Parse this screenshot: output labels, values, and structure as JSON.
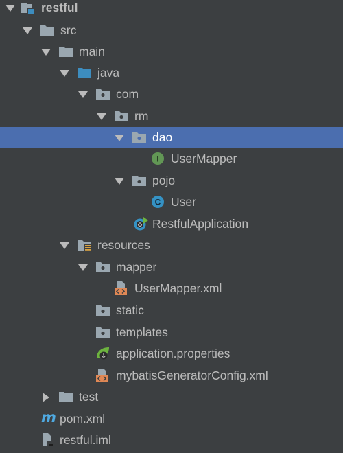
{
  "project_tree": {
    "root": {
      "label": "restful",
      "icon": "module-folder-icon"
    },
    "src": {
      "label": "src",
      "icon": "folder-icon"
    },
    "main": {
      "label": "main",
      "icon": "folder-icon"
    },
    "java": {
      "label": "java",
      "icon": "source-root-folder-icon"
    },
    "com": {
      "label": "com",
      "icon": "package-icon"
    },
    "rm": {
      "label": "rm",
      "icon": "package-icon"
    },
    "dao": {
      "label": "dao",
      "icon": "package-icon",
      "selected": true
    },
    "user_mapper": {
      "label": "UserMapper",
      "icon": "interface-icon",
      "badge": "I"
    },
    "pojo": {
      "label": "pojo",
      "icon": "package-icon"
    },
    "user": {
      "label": "User",
      "icon": "class-icon",
      "badge": "C"
    },
    "restful_application": {
      "label": "RestfulApplication",
      "icon": "spring-boot-app-icon"
    },
    "resources": {
      "label": "resources",
      "icon": "resources-root-icon"
    },
    "mapper": {
      "label": "mapper",
      "icon": "package-icon"
    },
    "user_mapper_xml": {
      "label": "UserMapper.xml",
      "icon": "xml-file-icon"
    },
    "static": {
      "label": "static",
      "icon": "folder-icon"
    },
    "templates": {
      "label": "templates",
      "icon": "folder-icon"
    },
    "application_properties": {
      "label": "application.properties",
      "icon": "spring-properties-icon"
    },
    "mybatis_generator_config": {
      "label": "mybatisGeneratorConfig.xml",
      "icon": "xml-file-icon"
    },
    "test": {
      "label": "test",
      "icon": "folder-icon"
    },
    "pom": {
      "label": "pom.xml",
      "icon": "maven-icon",
      "glyph": "m"
    },
    "restful_iml": {
      "label": "restful.iml",
      "icon": "iml-file-icon"
    }
  },
  "colors": {
    "background": "#3c3f41",
    "selection": "#4b6eaf",
    "text": "#bbbbbb",
    "folder": "#9aa7b0",
    "source_root": "#3d8dbf",
    "interface_green": "#629755",
    "class_blue": "#3592c4",
    "xml_orange": "#e08855",
    "spring_green": "#6db33f",
    "maven_blue": "#4fa9e0"
  }
}
